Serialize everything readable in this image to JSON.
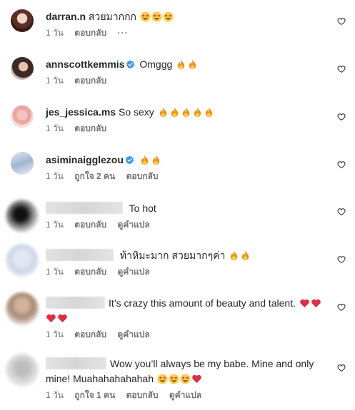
{
  "comments": [
    {
      "username": "darran.n",
      "text": "สวยมากกก",
      "emoji": [
        "star-eyes",
        "star-eyes",
        "star-eyes"
      ],
      "time": "1 วัน",
      "reply": "ตอบกลับ",
      "more": "···"
    },
    {
      "username": "annscottkemmis",
      "verified": true,
      "text": "Omggg",
      "emoji": [
        "fire",
        "fire"
      ],
      "time": "1 วัน",
      "reply": "ตอบกลับ"
    },
    {
      "username": "jes_jessica.ms",
      "text": "So sexy",
      "emoji": [
        "fire",
        "fire",
        "fire",
        "fire",
        "fire"
      ],
      "time": "1 วัน",
      "reply": "ตอบกลับ"
    },
    {
      "username": "asiminaigglezou",
      "verified": true,
      "text": "",
      "emoji": [
        "fire",
        "fire"
      ],
      "time": "1 วัน",
      "likes": "ถูกใจ 2 คน",
      "reply": "ตอบกลับ"
    },
    {
      "text": "To hot",
      "time": "1 วัน",
      "reply": "ตอบกลับ",
      "translate": "ดูคำแปล"
    },
    {
      "text": "ท้าหิมะมาก สวยมากๆค่า",
      "emoji": [
        "fire",
        "fire"
      ],
      "time": "1 วัน",
      "reply": "ตอบกลับ",
      "translate": "ดูคำแปล"
    },
    {
      "text": "It’s crazy this amount of beauty and talent.",
      "emoji": [
        "red-heart",
        "red-heart",
        "red-heart",
        "red-heart"
      ],
      "time": "1 วัน",
      "reply": "ตอบกลับ",
      "translate": "ดูคำแปล"
    },
    {
      "text_line1": "Wow you’ll always be my babe. Mine and only",
      "text_line2": "mine! Muahahahahahah",
      "emoji": [
        "star-eyes",
        "star-eyes",
        "star-eyes",
        "red-heart"
      ],
      "time": "1 วัน",
      "likes": "ถูกใจ 1 คน",
      "reply": "ตอบกลับ",
      "translate": "ดูคำแปล"
    }
  ],
  "colors": {
    "fire": "#f4900c",
    "heart": "#dd2e44",
    "face": "#ffcc4d",
    "verified": "#3897f0",
    "muted": "#737373"
  }
}
